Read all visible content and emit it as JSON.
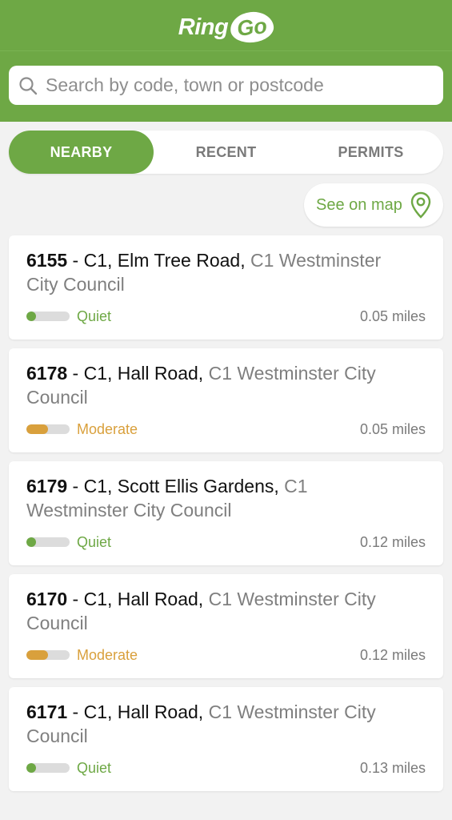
{
  "app": {
    "logo_ring": "Ring",
    "logo_go": "Go"
  },
  "colors": {
    "brand_green": "#6ea845",
    "moderate_amber": "#d9a03c",
    "quiet_green": "#6ea845"
  },
  "search": {
    "placeholder": "Search by code, town or postcode",
    "value": "",
    "icon": "search-icon"
  },
  "tabs": [
    {
      "label": "NEARBY",
      "active": true
    },
    {
      "label": "RECENT",
      "active": false
    },
    {
      "label": "PERMITS",
      "active": false
    }
  ],
  "map_button": {
    "label": "See on map",
    "icon": "map-pin-icon"
  },
  "locations": [
    {
      "code": "6155",
      "street": "C1, Elm Tree Road,",
      "council": "C1 Westminster City Council",
      "status": "Quiet",
      "level": 0.15,
      "distance": "0.05 miles"
    },
    {
      "code": "6178",
      "street": "C1, Hall Road,",
      "council": "C1 Westminster City Council",
      "status": "Moderate",
      "level": 0.5,
      "distance": "0.05 miles"
    },
    {
      "code": "6179",
      "street": "C1, Scott Ellis Gardens,",
      "council": "C1 Westminster City Council",
      "status": "Quiet",
      "level": 0.15,
      "distance": "0.12 miles"
    },
    {
      "code": "6170",
      "street": "C1, Hall Road,",
      "council": "C1 Westminster City Council",
      "status": "Moderate",
      "level": 0.5,
      "distance": "0.12 miles"
    },
    {
      "code": "6171",
      "street": "C1, Hall Road,",
      "council": "C1 Westminster City Council",
      "status": "Quiet",
      "level": 0.15,
      "distance": "0.13 miles"
    }
  ]
}
